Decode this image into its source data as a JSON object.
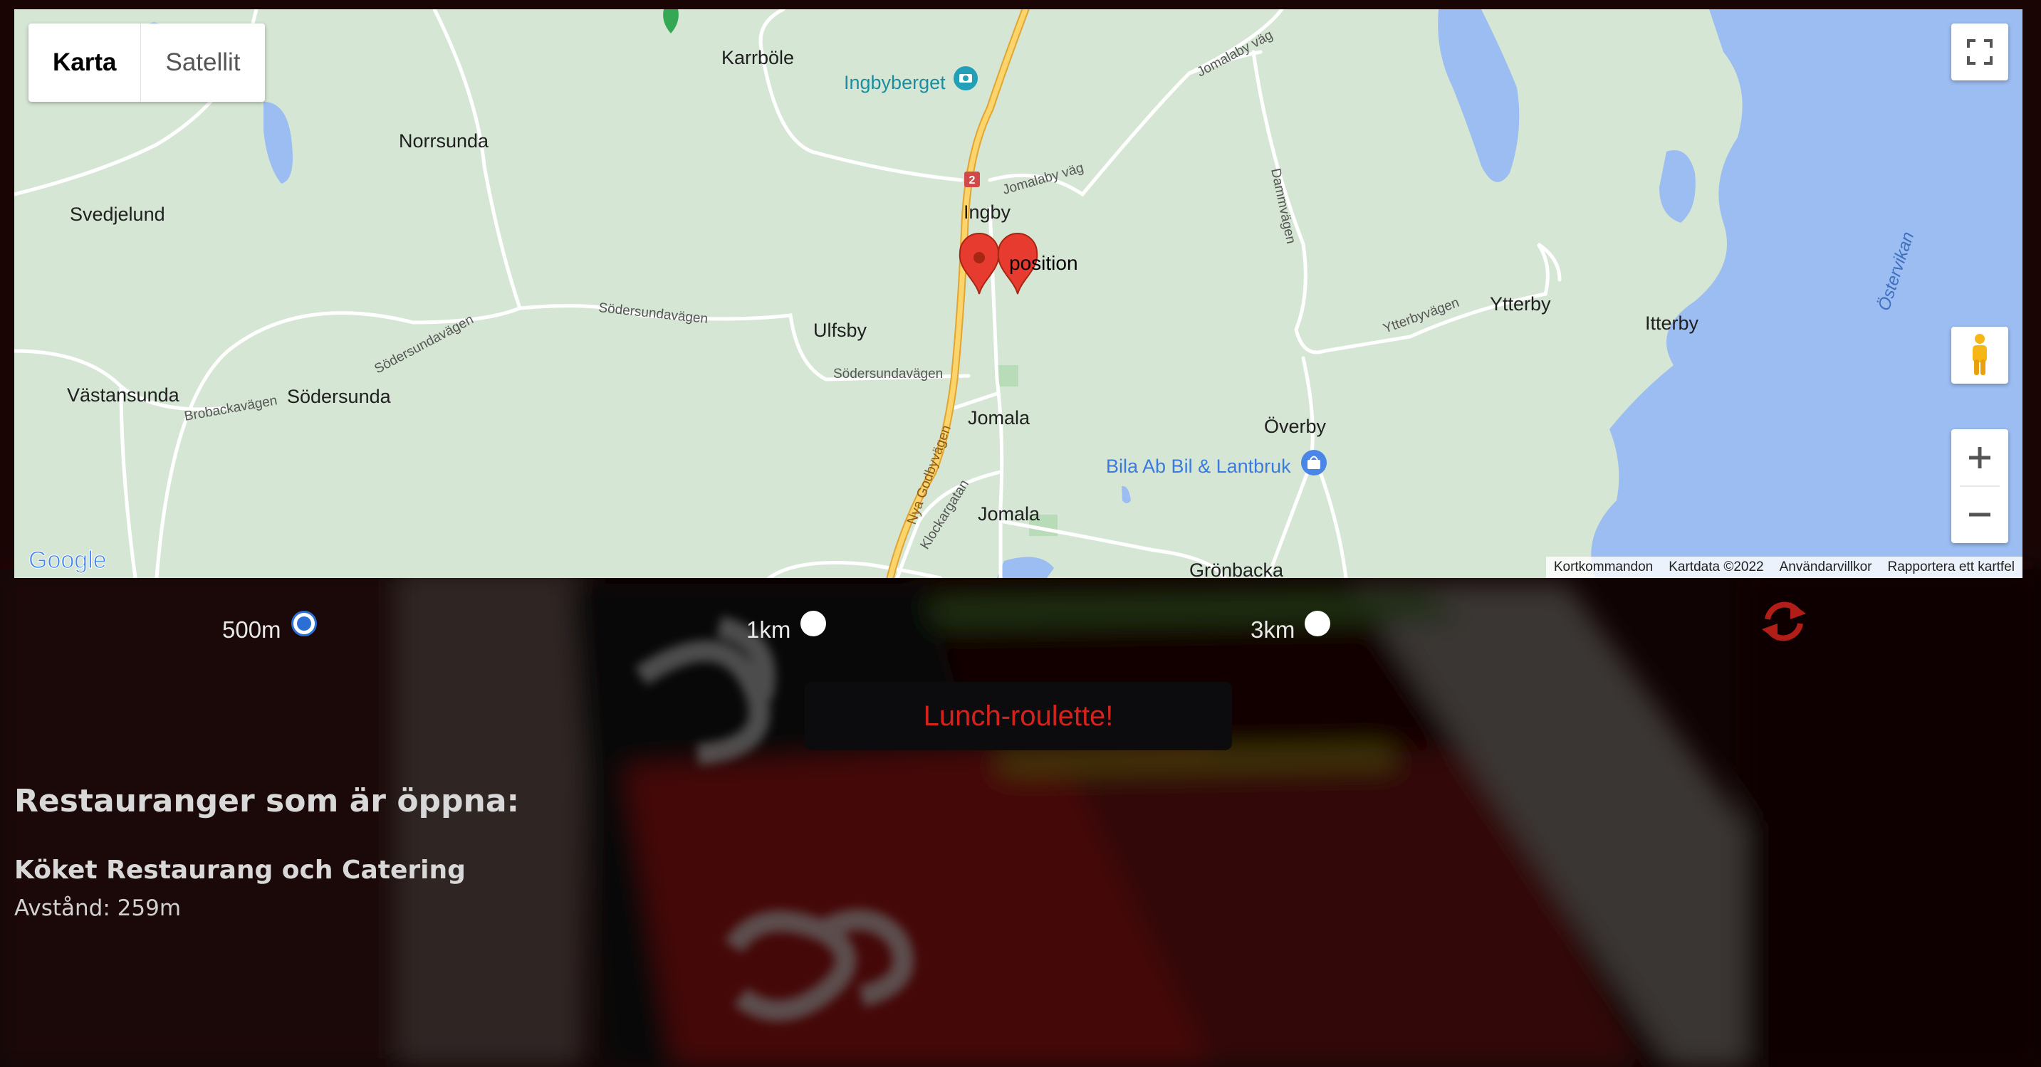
{
  "map": {
    "map_type_buttons": [
      "Karta",
      "Satellit"
    ],
    "places": {
      "karrbole": "Karrböle",
      "ingbyberget": "Ingbyberget",
      "norrsunda": "Norrsunda",
      "svedjelund": "Svedjelund",
      "ingby": "Ingby",
      "ulfsby": "Ulfsby",
      "vastansunda": "Västansunda",
      "sodersunda": "Södersunda",
      "jomala1": "Jomala",
      "jomala2": "Jomala",
      "ytterby": "Ytterby",
      "itterby": "Itterby",
      "overby": "Överby",
      "bila": "Bila Ab Bil & Lantbruk",
      "gronbacka": "Grönbacka",
      "ostervikan": "Östervikan"
    },
    "roads": {
      "jomalaby_vag_top": "Jomalaby väg",
      "jomalaby_vag": "Jomalaby väg",
      "dammvagen": "Dammvägen",
      "sodersundavagen1": "Södersundavägen",
      "sodersundavagen2": "Södersundavägen",
      "sodersundavagen3": "Södersundavägen",
      "brobackavagen": "Brobackavägen",
      "ytterbyvagen": "Ytterbyvägen",
      "nya_godbyvagen": "Nya Godbyvägen",
      "klockargatan": "Klockargatan",
      "route_number": "2"
    },
    "marker_label": "position",
    "google_logo": "Google",
    "attribution": [
      "Kortkommandon",
      "Kartdata ©2022",
      "Användarvillkor",
      "Rapportera ett kartfel"
    ]
  },
  "radius_options": [
    {
      "label": "500m",
      "checked": true
    },
    {
      "label": "1km",
      "checked": false
    },
    {
      "label": "3km",
      "checked": false
    }
  ],
  "roulette_button": "Lunch-roulette!",
  "results": {
    "heading": "Restauranger som är öppna:",
    "items": [
      {
        "name": "Köket Restaurang och Catering",
        "distance": "Avstånd: 259m"
      }
    ]
  },
  "colors": {
    "accent_red": "#d4221c",
    "radio_blue": "#2b6fd6",
    "map_land": "#d6e6d4",
    "map_water": "#9cbdf1"
  }
}
